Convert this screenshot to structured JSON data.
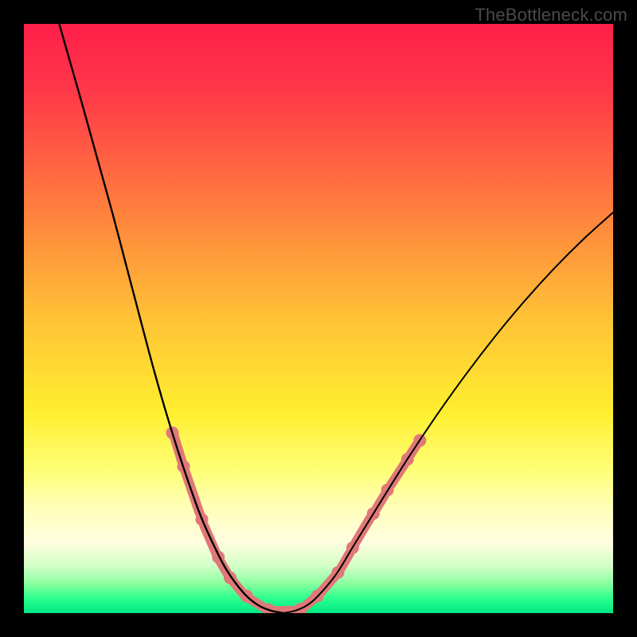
{
  "watermark": "TheBottleneck.com",
  "chart_data": {
    "type": "line",
    "title": "",
    "xlabel": "",
    "ylabel": "",
    "xlim": [
      0,
      100
    ],
    "ylim": [
      0,
      100
    ],
    "gradient_stops": [
      {
        "offset": 0.0,
        "color": "#ff1f4a"
      },
      {
        "offset": 0.12,
        "color": "#ff3a49"
      },
      {
        "offset": 0.3,
        "color": "#ff7a3e"
      },
      {
        "offset": 0.5,
        "color": "#ffc236"
      },
      {
        "offset": 0.66,
        "color": "#ffef2f"
      },
      {
        "offset": 0.76,
        "color": "#ffff7a"
      },
      {
        "offset": 0.82,
        "color": "#ffffb8"
      },
      {
        "offset": 0.88,
        "color": "#fffde0"
      },
      {
        "offset": 0.92,
        "color": "#d2ffc7"
      },
      {
        "offset": 0.95,
        "color": "#8affa0"
      },
      {
        "offset": 0.975,
        "color": "#2bff8d"
      },
      {
        "offset": 1.0,
        "color": "#00e886"
      }
    ],
    "series": [
      {
        "name": "left-branch",
        "color": "#000000",
        "width": 2.4,
        "points": [
          {
            "x": 6.0,
            "y": 100.0
          },
          {
            "x": 8.0,
            "y": 93.0
          },
          {
            "x": 10.0,
            "y": 86.0
          },
          {
            "x": 12.5,
            "y": 77.0
          },
          {
            "x": 15.0,
            "y": 68.0
          },
          {
            "x": 17.5,
            "y": 58.5
          },
          {
            "x": 20.0,
            "y": 49.0
          },
          {
            "x": 22.0,
            "y": 41.5
          },
          {
            "x": 24.0,
            "y": 34.5
          },
          {
            "x": 26.0,
            "y": 28.0
          },
          {
            "x": 28.0,
            "y": 22.0
          },
          {
            "x": 30.0,
            "y": 16.5
          },
          {
            "x": 32.0,
            "y": 12.0
          },
          {
            "x": 34.0,
            "y": 8.0
          },
          {
            "x": 36.0,
            "y": 5.0
          },
          {
            "x": 38.0,
            "y": 2.7
          },
          {
            "x": 40.0,
            "y": 1.2
          },
          {
            "x": 42.0,
            "y": 0.4
          },
          {
            "x": 44.0,
            "y": 0.0
          }
        ]
      },
      {
        "name": "right-branch",
        "color": "#000000",
        "width": 2.0,
        "points": [
          {
            "x": 44.0,
            "y": 0.0
          },
          {
            "x": 46.0,
            "y": 0.4
          },
          {
            "x": 48.0,
            "y": 1.3
          },
          {
            "x": 50.0,
            "y": 3.0
          },
          {
            "x": 53.0,
            "y": 6.6
          },
          {
            "x": 56.0,
            "y": 11.5
          },
          {
            "x": 60.0,
            "y": 18.0
          },
          {
            "x": 65.0,
            "y": 26.0
          },
          {
            "x": 70.0,
            "y": 33.5
          },
          {
            "x": 75.0,
            "y": 40.5
          },
          {
            "x": 80.0,
            "y": 47.0
          },
          {
            "x": 85.0,
            "y": 53.0
          },
          {
            "x": 90.0,
            "y": 58.5
          },
          {
            "x": 95.0,
            "y": 63.5
          },
          {
            "x": 100.0,
            "y": 68.0
          }
        ]
      }
    ],
    "marker_segments_left": [
      {
        "x1": 25.5,
        "y1": 30.0,
        "x2": 26.8,
        "y2": 25.8
      },
      {
        "x1": 27.4,
        "y1": 24.0,
        "x2": 29.8,
        "y2": 17.0
      },
      {
        "x1": 30.6,
        "y1": 14.8,
        "x2": 32.6,
        "y2": 10.2
      },
      {
        "x1": 33.3,
        "y1": 8.8,
        "x2": 34.6,
        "y2": 6.6
      },
      {
        "x1": 35.4,
        "y1": 5.5,
        "x2": 37.2,
        "y2": 3.3
      },
      {
        "x1": 38.2,
        "y1": 2.5,
        "x2": 41.0,
        "y2": 0.8
      },
      {
        "x1": 42.2,
        "y1": 0.35,
        "x2": 46.5,
        "y2": 0.45
      }
    ],
    "marker_segments_right": [
      {
        "x1": 47.5,
        "y1": 1.0,
        "x2": 49.3,
        "y2": 2.5
      },
      {
        "x1": 50.3,
        "y1": 3.4,
        "x2": 52.8,
        "y2": 6.3
      },
      {
        "x1": 53.8,
        "y1": 7.6,
        "x2": 55.3,
        "y2": 10.2
      },
      {
        "x1": 56.3,
        "y1": 12.0,
        "x2": 58.8,
        "y2": 16.2
      },
      {
        "x1": 59.8,
        "y1": 17.7,
        "x2": 61.2,
        "y2": 20.0
      },
      {
        "x1": 62.3,
        "y1": 21.8,
        "x2": 64.6,
        "y2": 25.3
      },
      {
        "x1": 65.6,
        "y1": 26.9,
        "x2": 66.8,
        "y2": 28.8
      }
    ],
    "marker_style": {
      "color": "#e07878",
      "width": 12,
      "cap": "round"
    },
    "dot_markers": [
      {
        "x": 25.2,
        "y": 30.6
      },
      {
        "x": 27.1,
        "y": 24.9
      },
      {
        "x": 30.2,
        "y": 15.9
      },
      {
        "x": 33.0,
        "y": 9.5
      },
      {
        "x": 35.0,
        "y": 6.0
      },
      {
        "x": 37.8,
        "y": 2.9
      },
      {
        "x": 41.6,
        "y": 0.55
      },
      {
        "x": 47.0,
        "y": 0.7
      },
      {
        "x": 49.8,
        "y": 2.9
      },
      {
        "x": 53.3,
        "y": 6.9
      },
      {
        "x": 55.8,
        "y": 11.1
      },
      {
        "x": 59.3,
        "y": 16.9
      },
      {
        "x": 61.7,
        "y": 20.9
      },
      {
        "x": 65.1,
        "y": 26.1
      },
      {
        "x": 67.2,
        "y": 29.3
      }
    ],
    "dot_style": {
      "color": "#e07878",
      "radius": 8
    }
  }
}
